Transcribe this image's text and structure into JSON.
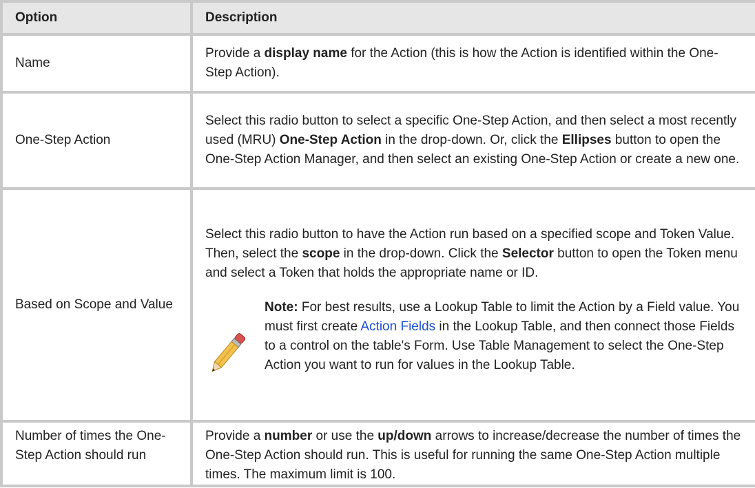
{
  "table": {
    "headers": {
      "option": "Option",
      "description": "Description"
    },
    "rows": [
      {
        "option": "Name",
        "d_a": "Provide a ",
        "d_b": "display name",
        "d_c": " for the Action (this is how the Action is identified within the One-Step Action)."
      },
      {
        "option": "One-Step Action",
        "d_a": "Select this radio button to select a specific One-Step Action, and then select a most recently used (MRU) ",
        "d_b": "One-Step Action",
        "d_c": " in the drop-down. Or, click the ",
        "d_d": "Ellipses",
        "d_e": " button to open the One-Step Action Manager, and then select an existing One-Step Action or create a new one."
      },
      {
        "option": "Based on Scope and Value",
        "d_a": "Select this radio button to have the Action run based on a specified scope and Token Value. Then, select the ",
        "d_b": "scope",
        "d_c": " in the drop-down. Click the ",
        "d_d": "Selector",
        "d_e": " button to open the Token menu and select a Token that holds the appropriate name or ID.",
        "note": {
          "icon": "pencil-icon",
          "label": "Note:",
          "t1": " For best results, use a Lookup Table to limit the Action by a Field value. You must first create ",
          "link": "Action Fields",
          "t2": " in the Lookup Table, and then connect those Fields to a control on the table's Form. Use Table Management to select the One-Step Action you want to run for values in the Lookup Table."
        }
      },
      {
        "option": "Number of times the One-Step Action should run",
        "d_a": "Provide a ",
        "d_b": "number",
        "d_c": " or use the ",
        "d_d": "up/down",
        "d_e": " arrows to increase/decrease the number of times the One-Step Action should run. This is useful for running the same One-Step Action multiple times. The maximum limit is 100."
      }
    ]
  }
}
